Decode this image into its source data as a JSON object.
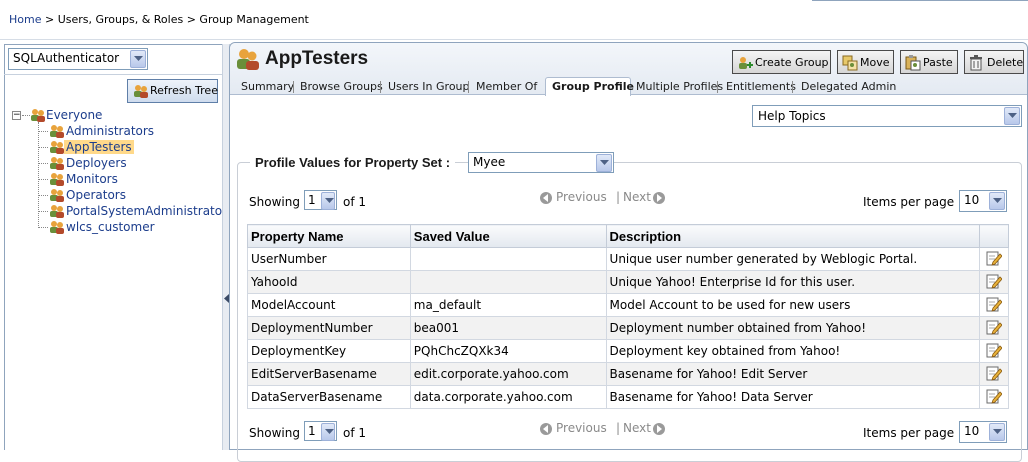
{
  "breadcrumb": {
    "home": "Home",
    "path": " > Users, Groups, & Roles > Group Management"
  },
  "left": {
    "authenticator": "SQLAuthenticator",
    "refresh_label": "Refresh Tree",
    "tree": {
      "root": "Everyone",
      "children": [
        "Administrators",
        "AppTesters",
        "Deployers",
        "Monitors",
        "Operators",
        "PortalSystemAdministrators",
        "wlcs_customer"
      ],
      "selected": "AppTesters"
    }
  },
  "group": {
    "title": "AppTesters"
  },
  "toolbar": {
    "create_group": "Create Group",
    "move": "Move",
    "paste": "Paste",
    "delete": "Delete"
  },
  "tabs": [
    "Summary",
    "Browse Groups",
    "Users In Group",
    "Member Of",
    "Group Profile",
    "Multiple Profiles",
    "Entitlements",
    "Delegated Admin"
  ],
  "active_tab": "Group Profile",
  "help": {
    "label": "Help Topics"
  },
  "profile": {
    "legend": "Profile Values for Property Set :",
    "property_set": "Myee"
  },
  "pager": {
    "showing": "Showing",
    "page": "1",
    "of": "of 1",
    "previous": "Previous",
    "separator": "|",
    "next": "Next",
    "items_per_page": "Items per page",
    "ipp_value": "10"
  },
  "table": {
    "headers": [
      "Property Name",
      "Saved Value",
      "Description"
    ],
    "rows": [
      {
        "name": "UserNumber",
        "value": "",
        "description": "Unique user number generated by Weblogic Portal."
      },
      {
        "name": "YahooId",
        "value": "",
        "description": "Unique Yahoo! Enterprise Id for this user."
      },
      {
        "name": "ModelAccount",
        "value": "ma_default",
        "description": "Model Account to be used for new users"
      },
      {
        "name": "DeploymentNumber",
        "value": "bea001",
        "description": "Deployment number obtained from Yahoo!"
      },
      {
        "name": "DeploymentKey",
        "value": "PQhChcZQXk34",
        "description": "Deployment key obtained from Yahoo!"
      },
      {
        "name": "EditServerBasename",
        "value": "edit.corporate.yahoo.com",
        "description": "Basename for Yahoo! Edit Server"
      },
      {
        "name": "DataServerBasename",
        "value": "data.corporate.yahoo.com",
        "description": "Basename for Yahoo! Data Server"
      }
    ]
  }
}
